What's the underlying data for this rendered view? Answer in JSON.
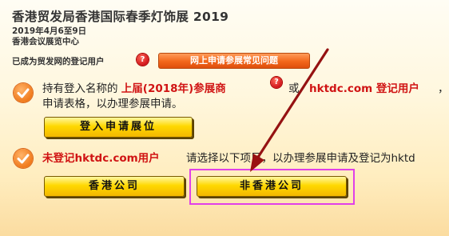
{
  "header": {
    "title": "香港贸发局香港国际春季灯饰展 2019",
    "date": "2019年4月6至9日",
    "venue": "香港会议展览中心"
  },
  "registered": {
    "label": "已成为贸发网的登记用户",
    "help_glyph": "?",
    "faq_button": "网上申请参展常见问题"
  },
  "section_existing": {
    "text_prefix": "持有登入名称的",
    "highlight_prev": "上届(2018年)参展商",
    "or_text": "或",
    "highlight_hktdc": "hktdc.com 登记用户",
    "tail": "，",
    "line2": "申请表格，以办理参展申请。",
    "login_button": "登入申请展位"
  },
  "section_new": {
    "highlight": "未登记hktdc.com用户",
    "text": "请选择以下项目，以办理参展申请及登记为hktd",
    "hk_button": "香港公司",
    "non_hk_button": "非香港公司"
  },
  "colors": {
    "accent_red": "#d01414",
    "faq_orange": "#f2671b",
    "button_yellow": "#ffd800",
    "highlight_magenta": "#e040e8",
    "arrow": "#9a1010"
  },
  "icons": {
    "check": "check-circle-icon",
    "help": "help-circle-icon",
    "arrow": "annotation-arrow"
  }
}
